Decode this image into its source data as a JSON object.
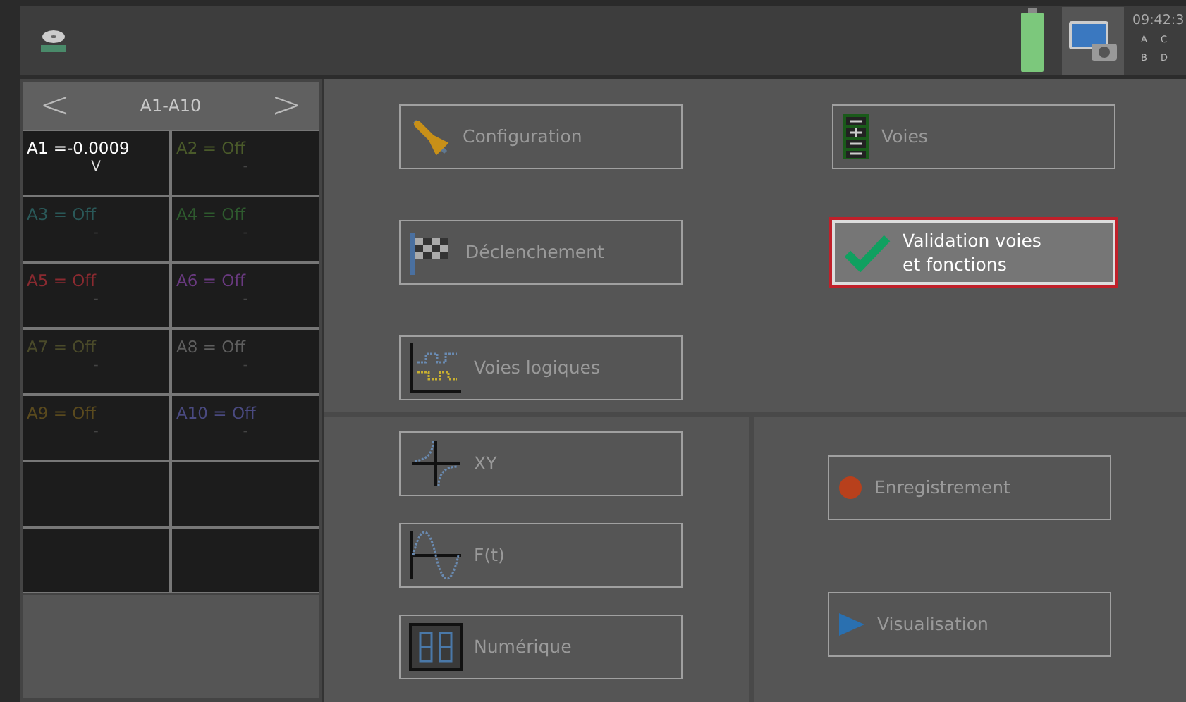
{
  "top_bar": {
    "time": "09:42:3",
    "indicators": [
      "A",
      "C",
      "B",
      "D"
    ]
  },
  "channel_panel": {
    "title": "A1-A10",
    "prev": "<",
    "next": ">",
    "cells": [
      {
        "label": "A1 =-0.0009",
        "unit": "V",
        "color": "#ffffff"
      },
      {
        "label": "A2 = Off",
        "unit": "-",
        "color": "#4a5a2a"
      },
      {
        "label": "A3 = Off",
        "unit": "-",
        "color": "#2a5858"
      },
      {
        "label": "A4 = Off",
        "unit": "-",
        "color": "#2e5a2e"
      },
      {
        "label": "A5 = Off",
        "unit": "-",
        "color": "#8a2a30"
      },
      {
        "label": "A6 = Off",
        "unit": "-",
        "color": "#6a3a80"
      },
      {
        "label": "A7 = Off",
        "unit": "-",
        "color": "#4a4a2a"
      },
      {
        "label": "A8 = Off",
        "unit": "-",
        "color": "#5e5e5e"
      },
      {
        "label": "A9 = Off",
        "unit": "-",
        "color": "#5a4a1e"
      },
      {
        "label": "A10 = Off",
        "unit": "-",
        "color": "#4a4a80"
      }
    ]
  },
  "setup_buttons": [
    {
      "label": "Configuration",
      "kind": "config",
      "selected": false
    },
    {
      "label": "Voies",
      "kind": "channels",
      "selected": false
    },
    {
      "label": "Déclenchement",
      "kind": "trigger",
      "selected": false
    },
    {
      "label": "Validation voies\net fonctions",
      "kind": "check",
      "selected": true
    },
    {
      "label": "Voies logiques",
      "kind": "logic",
      "selected": false
    }
  ],
  "display_buttons": [
    {
      "label": "XY",
      "kind": "xy",
      "selected": false
    },
    {
      "label": "F(t)",
      "kind": "ft",
      "selected": false
    },
    {
      "label": "Numérique",
      "kind": "digital",
      "selected": false
    }
  ],
  "action_buttons": [
    {
      "label": "Enregistrement",
      "kind": "record",
      "selected": false
    },
    {
      "label": "Visualisation",
      "kind": "play",
      "selected": false
    }
  ]
}
